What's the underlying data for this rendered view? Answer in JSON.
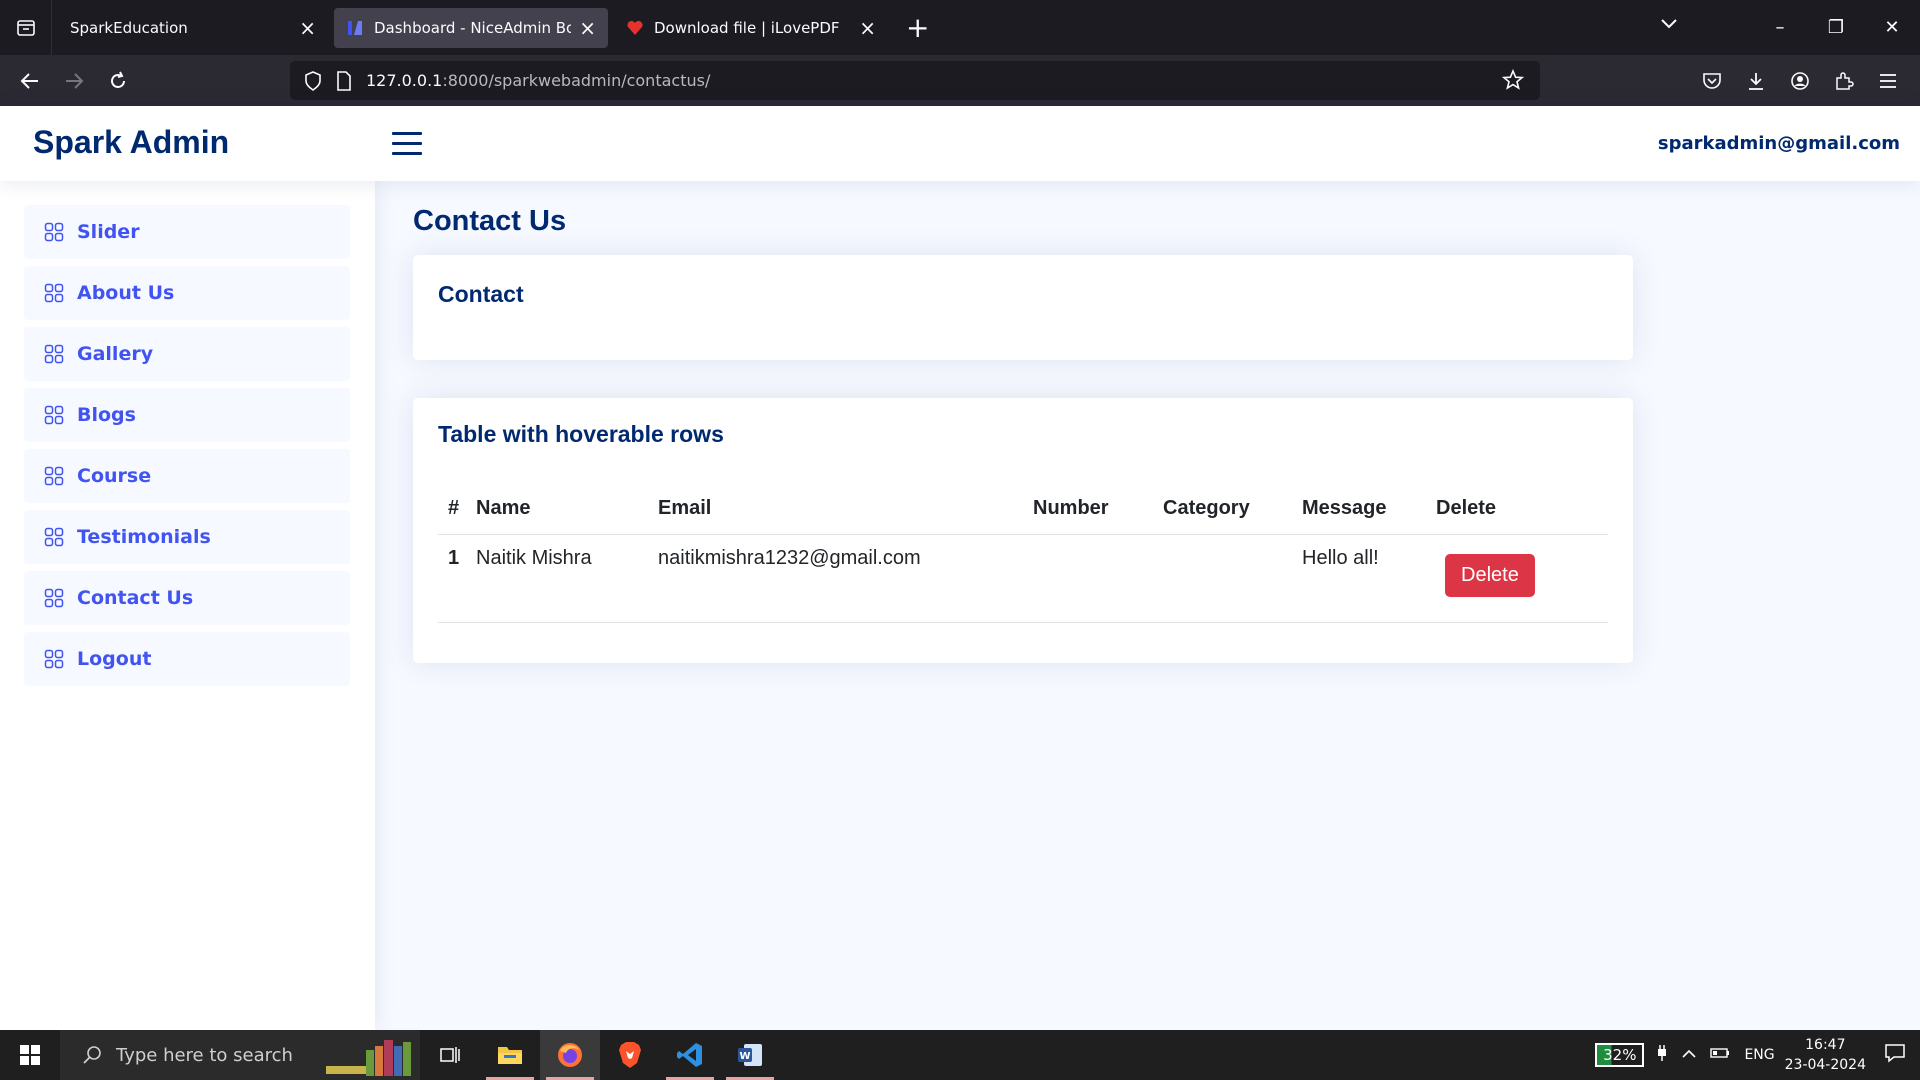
{
  "browser": {
    "tabs": [
      {
        "title": "SparkEducation",
        "active": false
      },
      {
        "title": "Dashboard - NiceAdmin Bootst",
        "active": true
      },
      {
        "title": "Download file | iLovePDF",
        "active": false
      }
    ],
    "url_host": "127.0.0.1",
    "url_rest": ":8000/sparkwebadmin/contactus/"
  },
  "header": {
    "logo": "Spark Admin",
    "user_email": "sparkadmin@gmail.com"
  },
  "sidebar": {
    "items": [
      {
        "label": "Slider"
      },
      {
        "label": "About Us"
      },
      {
        "label": "Gallery"
      },
      {
        "label": "Blogs"
      },
      {
        "label": "Course"
      },
      {
        "label": "Testimonials"
      },
      {
        "label": "Contact Us"
      },
      {
        "label": "Logout"
      }
    ]
  },
  "main": {
    "page_title": "Contact Us",
    "contact_card_title": "Contact",
    "table_card_title": "Table with hoverable rows",
    "table": {
      "headers": [
        "#",
        "Name",
        "Email",
        "Number",
        "Category",
        "Message",
        "Delete"
      ],
      "rows": [
        {
          "num": "1",
          "name": "Naitik Mishra",
          "email": "naitikmishra1232@gmail.com",
          "number": "",
          "category": "",
          "message": "Hello all!",
          "action": "Delete"
        }
      ]
    }
  },
  "taskbar": {
    "search_placeholder": "Type here to search",
    "battery": "32%",
    "language": "ENG",
    "time": "16:47",
    "date": "23-04-2024"
  },
  "colors": {
    "brand": "#012970",
    "accent": "#4154f1",
    "danger": "#dc3545"
  }
}
